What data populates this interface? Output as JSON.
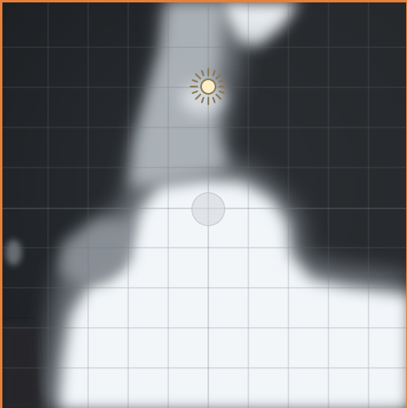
{
  "scene_view": {
    "frame_color": "#e8803a",
    "background_color": "#25282c",
    "surface_color": "#f2f6f9",
    "grid_color": "#6a6f75"
  },
  "gizmos": {
    "light_icon": "directional-light-sun-icon",
    "pivot_icon": "transform-pivot-handle"
  }
}
